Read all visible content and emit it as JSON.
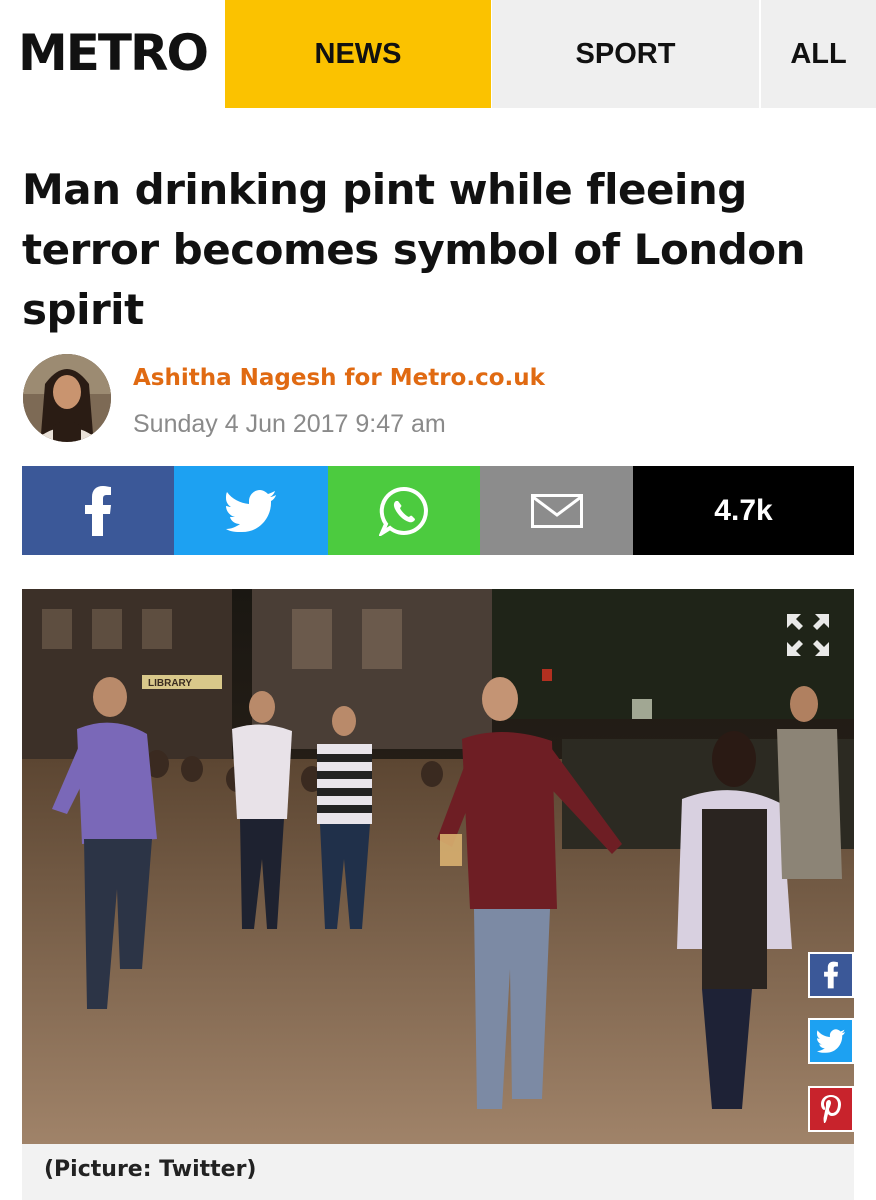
{
  "header": {
    "logo_text": "METRO",
    "nav": [
      {
        "label": "NEWS"
      },
      {
        "label": "SPORT"
      },
      {
        "label": "ALL"
      }
    ]
  },
  "article": {
    "headline": "Man drinking pint while fleeing terror becomes symbol of London spirit",
    "author": "Ashitha Nagesh for Metro.co.uk",
    "date": "Sunday 4 Jun 2017 9:47 am"
  },
  "share_bar": {
    "count": "4.7k",
    "icons": [
      "facebook-icon",
      "twitter-icon",
      "whatsapp-icon",
      "email-icon"
    ]
  },
  "photo": {
    "caption": "(Picture: Twitter)",
    "sign_text": "LIBRARY"
  },
  "colors": {
    "accent": "#fbc200",
    "author": "#e06a12",
    "facebook": "#3b5898",
    "twitter": "#1da1f2",
    "whatsapp": "#4ccb3f",
    "email": "#8c8c8c",
    "pinterest": "#c8232c"
  }
}
